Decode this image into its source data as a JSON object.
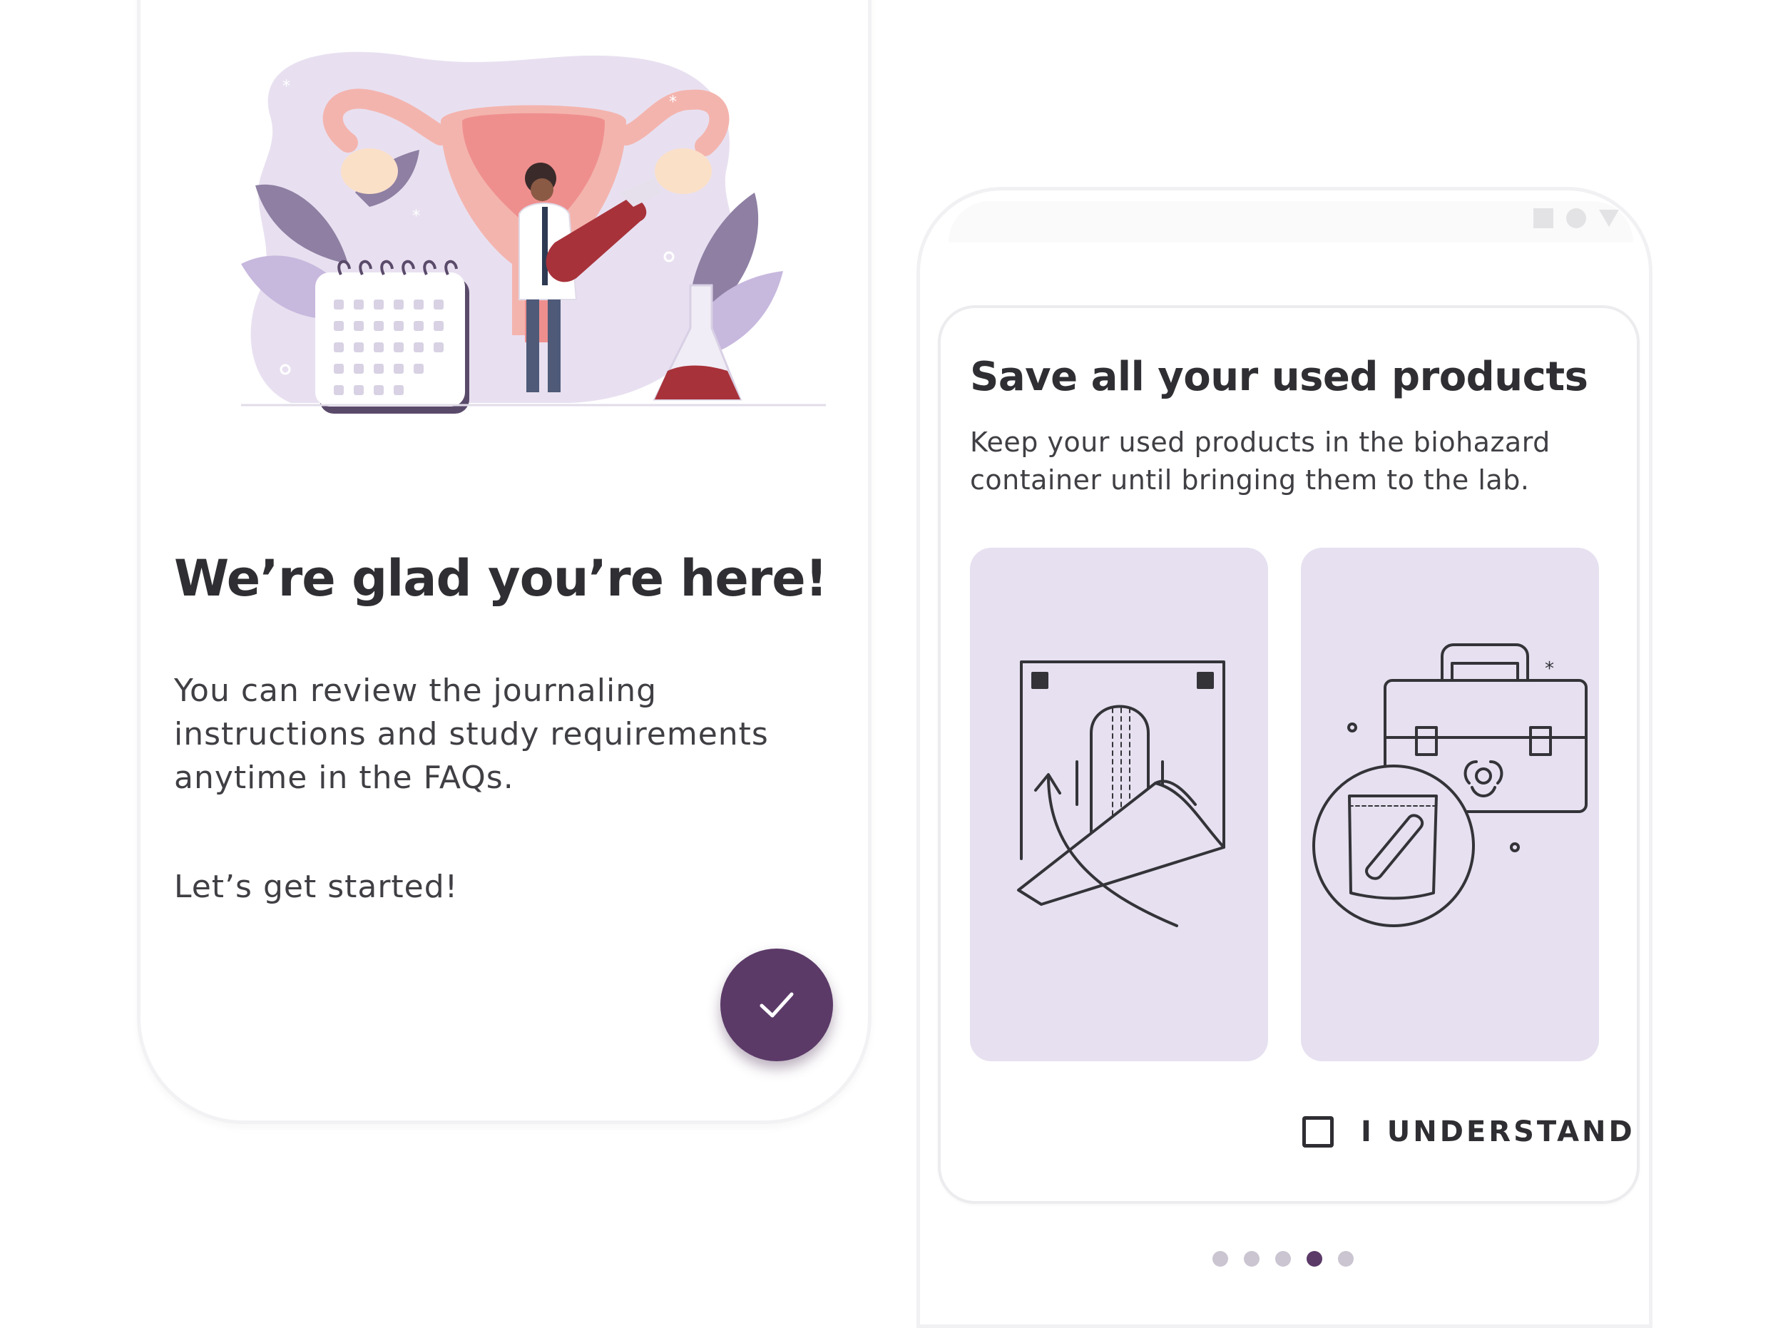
{
  "welcome_screen": {
    "title": "We’re glad you’re here!",
    "body": "You can review the journaling instructions and study requirements anytime in the FAQs.",
    "start_text": "Let’s get started!",
    "confirm_icon": "check-icon",
    "illustration": "researcher-uterus-lab-illustration"
  },
  "instruction_screen": {
    "title": "Save all your used products",
    "body": "Keep your used products in the biohazard container until bringing them to the lab.",
    "panels": [
      {
        "icon": "wrap-used-pad-icon"
      },
      {
        "icon": "biohazard-container-bag-icon"
      }
    ],
    "acknowledge_label": "I UNDERSTAND",
    "acknowledge_checked": false
  },
  "pager": {
    "total": 5,
    "active_index": 3
  },
  "colors": {
    "accent": "#5b3a68",
    "panel_bg": "#e6e0f0",
    "dot_inactive": "#cac5d0"
  }
}
